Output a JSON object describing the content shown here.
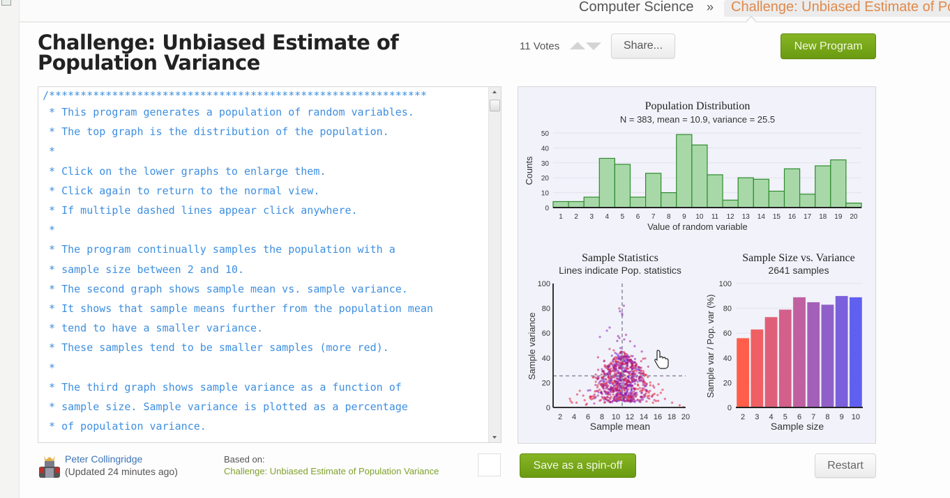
{
  "breadcrumb": {
    "parent": "Computer Science",
    "separator": "»",
    "current": "Challenge: Unbiased Estimate of Population Variance"
  },
  "page_title": "Challenge: Unbiased Estimate of Population Variance",
  "votes": {
    "label": "11 Votes"
  },
  "buttons": {
    "share": "Share...",
    "new_program": "New Program",
    "save_spinoff": "Save as a spin-off",
    "restart": "Restart"
  },
  "code_lines": [
    "/************************************************************",
    " * This program generates a population of random variables.",
    " * The top graph is the distribution of the population.",
    " *",
    " * Click on the lower graphs to enlarge them.",
    " * Click again to return to the normal view.",
    " * If multiple dashed lines appear click anywhere.",
    " *",
    " * The program continually samples the population with a",
    " * sample size between 2 and 10.",
    " * The second graph shows sample mean vs. sample variance.",
    " * It shows that sample means further from the population mean",
    " * tend to have a smaller variance.",
    " * These samples tend to be smaller samples (more red).",
    " *",
    " * The third graph shows sample variance as a function of",
    " * sample size. Sample variance is plotted as a percentage",
    " * of population variance."
  ],
  "footer": {
    "author": "Peter Collingridge",
    "updated": "(Updated 24 minutes ago)",
    "based_on_label": "Based on:",
    "based_on_link": "Challenge: Unbiased Estimate of Population Variance"
  },
  "colors": {
    "accent_green": "#76a815",
    "breadcrumb_orange": "#e0894a",
    "code_blue": "#3e8fe0",
    "hist_fill": "#a8d8a8",
    "hist_stroke": "#2e8b2e"
  },
  "chart_data": [
    {
      "type": "bar",
      "title": "Population Distribution",
      "subtitle": "N = 383, mean = 10.9, variance = 25.5",
      "xlabel": "Value of random variable",
      "ylabel": "Counts",
      "categories": [
        "1",
        "2",
        "3",
        "4",
        "5",
        "6",
        "7",
        "8",
        "9",
        "10",
        "11",
        "12",
        "13",
        "14",
        "15",
        "16",
        "17",
        "18",
        "19",
        "20"
      ],
      "values": [
        4,
        4,
        7,
        33,
        29,
        7,
        23,
        10,
        49,
        42,
        22,
        5,
        20,
        19,
        11,
        26,
        9,
        28,
        32,
        3
      ],
      "ylim": [
        0,
        50
      ],
      "yticks": [
        0,
        10,
        20,
        30,
        40,
        50
      ],
      "grid": true
    },
    {
      "type": "scatter",
      "title": "Sample Statistics",
      "subtitle": "Lines indicate Pop. statistics",
      "xlabel": "Sample mean",
      "ylabel": "Sample variance",
      "xlim": [
        1,
        20
      ],
      "ylim": [
        0,
        100
      ],
      "xticks": [
        2,
        4,
        6,
        8,
        10,
        12,
        14,
        16,
        18,
        20
      ],
      "yticks": [
        0,
        20,
        40,
        60,
        80,
        100
      ],
      "reference_lines": {
        "x_mean": 10.9,
        "y_variance": 25.5
      },
      "sample_count": 2641,
      "distribution_note": "dense cloud centered near mean 10.9, variance 0-80; color red (small samples) to blue (large samples)"
    },
    {
      "type": "bar",
      "title": "Sample Size vs. Variance",
      "subtitle": "2641 samples",
      "xlabel": "Sample size",
      "ylabel": "Sample var / Pop. var (%)",
      "categories": [
        "2",
        "3",
        "4",
        "5",
        "6",
        "7",
        "8",
        "9",
        "10"
      ],
      "values": [
        56,
        63,
        73,
        79,
        89,
        85,
        83,
        90,
        89
      ],
      "ylim": [
        0,
        100
      ],
      "yticks": [
        0,
        20,
        40,
        60,
        80,
        100
      ],
      "bar_colors": [
        "#ff5f4a",
        "#ef5f63",
        "#e05f78",
        "#d45f8a",
        "#c060a0",
        "#a460b8",
        "#9060c8",
        "#7a60dc",
        "#6060f0"
      ],
      "grid": true
    }
  ]
}
